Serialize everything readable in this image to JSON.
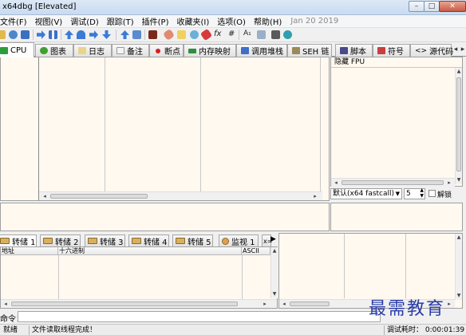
{
  "window": {
    "title": "x64dbg [Elevated]",
    "controls": {
      "minimize": "–",
      "maximize": "□",
      "close": "✕"
    }
  },
  "menu": {
    "items": [
      "文件(F)",
      "视图(V)",
      "调试(D)",
      "跟踪(T)",
      "插件(P)",
      "收藏夹(I)",
      "选项(O)",
      "帮助(H)"
    ],
    "date": "Jan 20 2019"
  },
  "toolbar": {
    "fx_label": "fx",
    "hash_label": "#",
    "font_label": "A₁",
    "icons": [
      "open-icon",
      "restart-icon",
      "close-icon",
      "run-icon",
      "pause-icon",
      "step-into-icon",
      "step-over-icon",
      "trace-into-icon",
      "trace-over-icon",
      "execute-till-return-icon",
      "run-to-user-code-icon",
      "scylla-icon",
      "patch-icon",
      "comments-icon",
      "labels-icon",
      "bookmarks-icon",
      "functions-icon",
      "calculator-icon",
      "help-icon"
    ]
  },
  "tabs": [
    {
      "label": "CPU",
      "icon": "cpu-icon",
      "color": "#2e9c3b"
    },
    {
      "label": "图表",
      "icon": "graph-icon",
      "color": "#3f9f2f"
    },
    {
      "label": "日志",
      "icon": "log-icon",
      "color": "#e8d58a"
    },
    {
      "label": "备注",
      "icon": "notes-icon",
      "color": "#f4f4f4"
    },
    {
      "label": "断点",
      "icon": "breakpoint-icon",
      "color": "#d81e1e"
    },
    {
      "label": "内存映射",
      "icon": "memory-map-icon",
      "color": "#2f8f3f"
    },
    {
      "label": "调用堆栈",
      "icon": "call-stack-icon",
      "color": "#3f6fc8"
    },
    {
      "label": "SEH 链",
      "icon": "seh-chain-icon",
      "color": "#9a8a5a"
    },
    {
      "label": "脚本",
      "icon": "script-icon",
      "color": "#4a4a8a"
    },
    {
      "label": "符号",
      "icon": "symbols-icon",
      "color": "#c83f3f"
    },
    {
      "label": "源代码",
      "icon": "source-icon",
      "color": "#444444"
    }
  ],
  "registers": {
    "header": "隐藏 FPU"
  },
  "call_convention": {
    "selected": "默认(x64 fastcall)",
    "arg_count": "5",
    "unlock_label": "解锁"
  },
  "dump_tabs": [
    "转储 1",
    "转储 2",
    "转储 3",
    "转储 4",
    "转储 5"
  ],
  "watch_tab": "监视 1",
  "dump_columns": [
    "地址",
    "十六进制",
    "ASCII"
  ],
  "command": {
    "label": "命令：",
    "value": ""
  },
  "status": {
    "state": "就绪",
    "message": "文件读取线程完成！",
    "timer": "调试耗时：  0:00:01:39"
  },
  "watermark": "最需教育",
  "colors": {
    "pane_background": "#fff9f0",
    "accent": "#2a3da8"
  }
}
